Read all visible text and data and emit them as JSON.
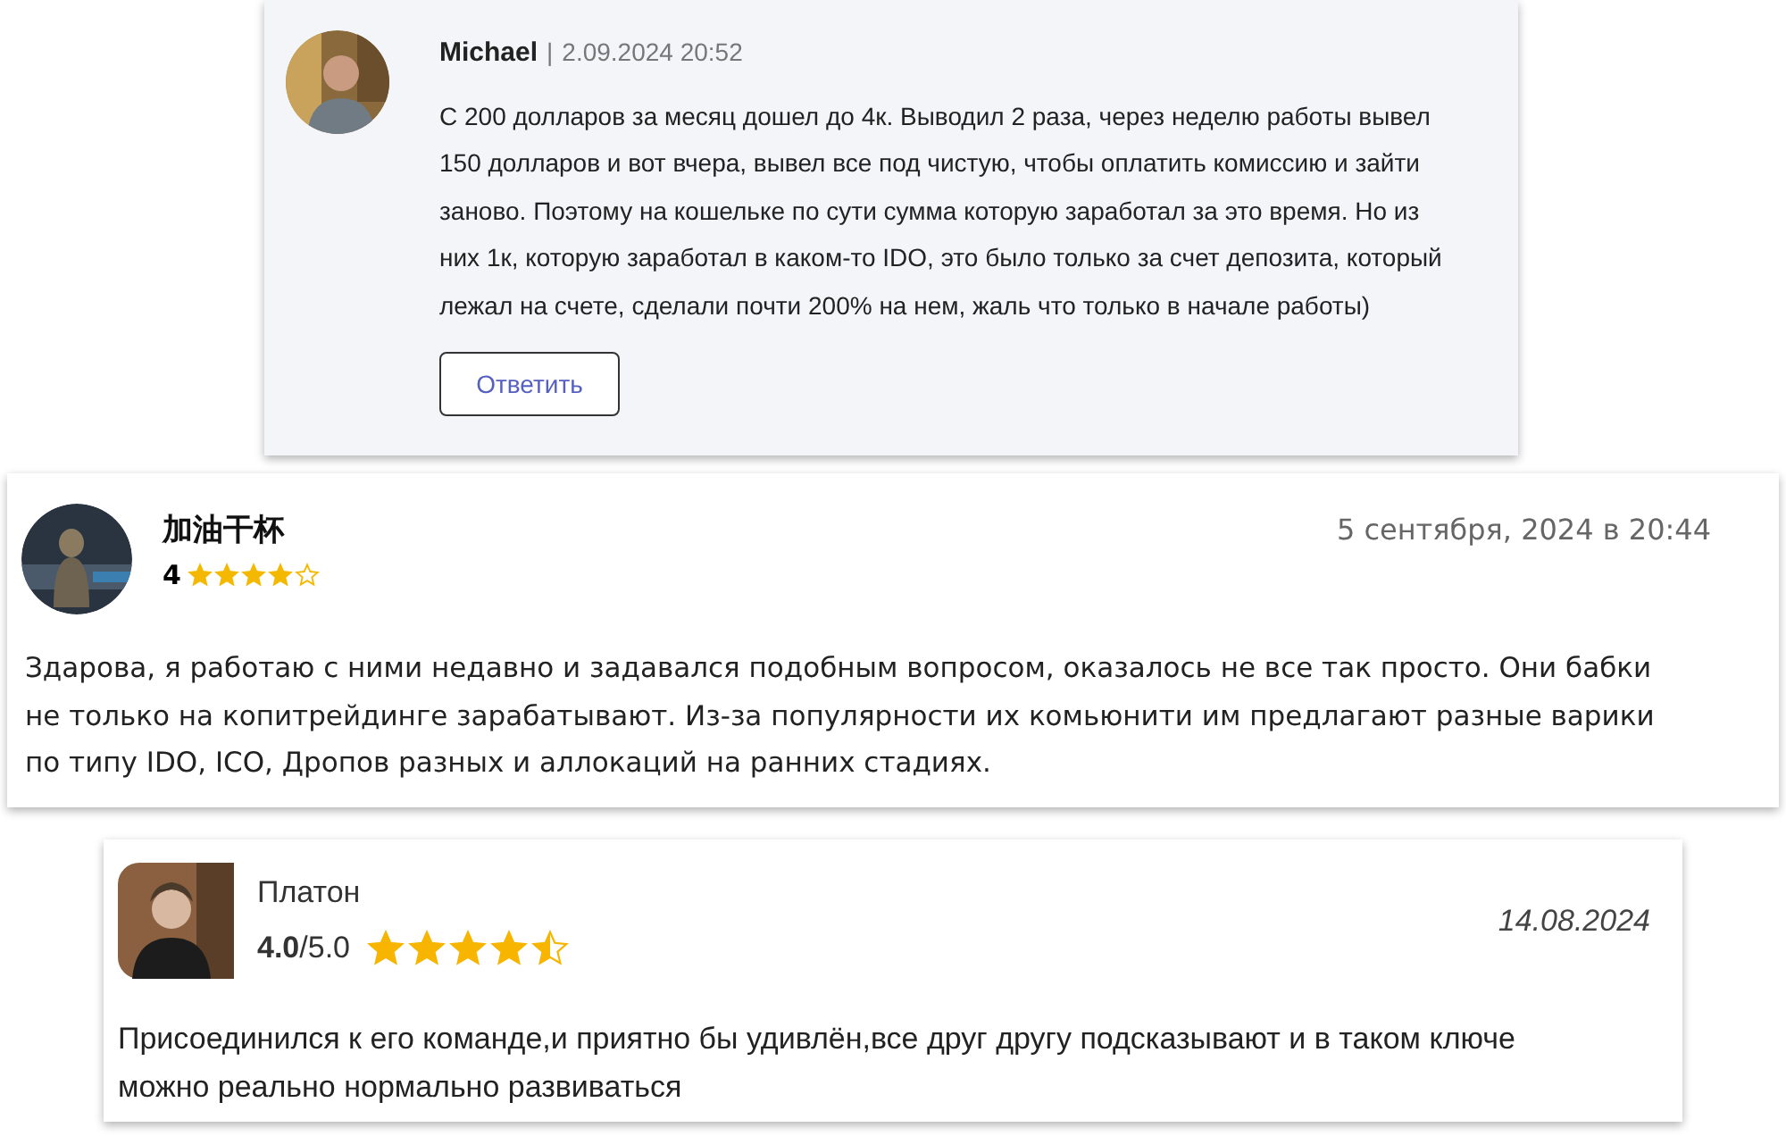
{
  "reviews": [
    {
      "kind": "threaded",
      "name": "Michael",
      "separator": "|",
      "date": "2.09.2024 20:52",
      "text": "С 200 долларов за месяц дошел до 4к. Выводил 2 раза, через неделю работы вывел 150 долларов и вот вчера, вывел все под чистую, чтобы оплатить комиссию и зайти заново. Поэтому на кошельке по сути сумма которую заработал за это время. Но из них 1к, которую заработал в каком-то IDO, это было только за счет депозита, который лежал на счете, сделали почти 200% на нем, жаль что только в начале работы)",
      "reply_button": "Ответить"
    },
    {
      "kind": "rated",
      "name": "加油干杯",
      "score": "4",
      "stars": 4,
      "date": "5 сентября, 2024 в 20:44",
      "text": "Здарова, я работаю с ними недавно и задавался подобным вопросом, оказалось не все так просто. Они бабки не только на копитрейдинге зарабатывают. Из-за популярности их комьюнити им предлагают разные варики по типу IDO, ICO, Дропов разных и аллокаций на ранних стадиях."
    },
    {
      "kind": "compact",
      "name": "Платон",
      "score": "**4.0**/5.0",
      "stars": 4.5,
      "date": "14.08.2024",
      "text": "Присоединился к его команде,и приятно бы удивлён,все друг другу подсказывают и в таком ключе можно реально нормально развиваться"
    }
  ]
}
